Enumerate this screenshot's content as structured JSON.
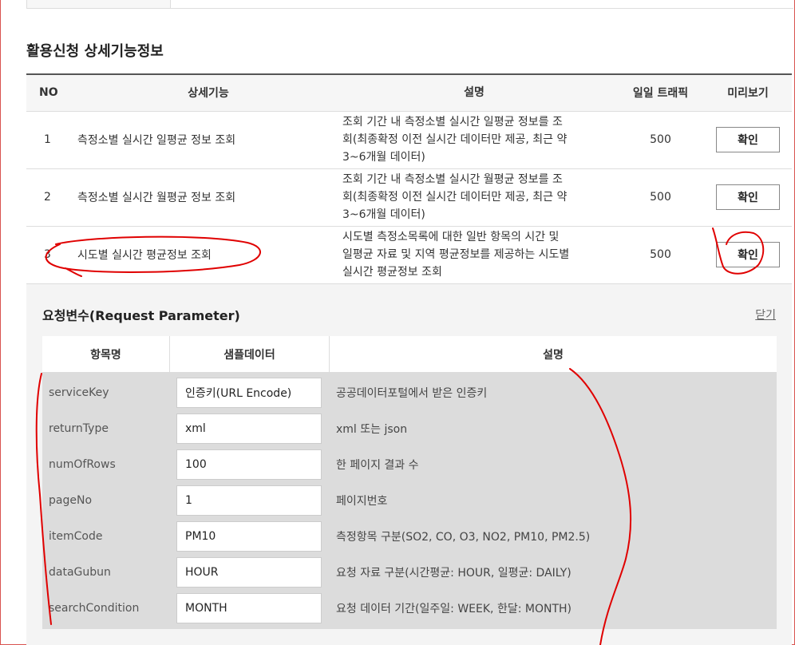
{
  "section_title": "활용신청 상세기능정보",
  "detail_table": {
    "headers": [
      "NO",
      "상세기능",
      "설명",
      "일일 트래픽",
      "미리보기"
    ],
    "rows": [
      {
        "no": "1",
        "func": "측정소별 실시간 일평균 정보 조회",
        "desc": [
          "조회 기간 내 측정소별 실시간 일평균 정보를 조",
          "회(최종확정 이전 실시간 데이터만 제공, 최근 약",
          "3~6개월 데이터)"
        ],
        "traffic": "500",
        "button": "확인"
      },
      {
        "no": "2",
        "func": "측정소별 실시간 월평균 정보 조회",
        "desc": [
          "조회 기간 내 측정소별 실시간 월평균 정보를 조",
          "회(최종확정 이전 실시간 데이터만 제공, 최근 약",
          "3~6개월 데이터)"
        ],
        "traffic": "500",
        "button": "확인"
      },
      {
        "no": "3",
        "func": "시도별 실시간 평균정보 조회",
        "desc": [
          "시도별 측정소목록에 대한 일반 항목의 시간 및",
          "일평균 자료 및 지역 평균정보를 제공하는 시도별",
          "실시간 평균정보 조회"
        ],
        "traffic": "500",
        "button": "확인"
      }
    ]
  },
  "param_panel": {
    "title": "요청변수(Request Parameter)",
    "close_label": "닫기",
    "headers": [
      "항목명",
      "샘플데이터",
      "설명"
    ],
    "rows": [
      {
        "name": "serviceKey",
        "sample": "인증키(URL Encode)",
        "desc": "공공데이터포털에서 받은 인증키"
      },
      {
        "name": "returnType",
        "sample": "xml",
        "desc": "xml 또는 json"
      },
      {
        "name": "numOfRows",
        "sample": "100",
        "desc": "한 페이지 결과 수"
      },
      {
        "name": "pageNo",
        "sample": "1",
        "desc": "페이지번호"
      },
      {
        "name": "itemCode",
        "sample": "PM10",
        "desc": "측정항목 구분(SO2, CO, O3, NO2, PM10, PM2.5)"
      },
      {
        "name": "dataGubun",
        "sample": "HOUR",
        "desc": "요청 자료 구분(시간평균: HOUR, 일평균: DAILY)"
      },
      {
        "name": "searchCondition",
        "sample": "MONTH",
        "desc": "요청 데이터 기간(일주일: WEEK, 한달: MONTH)"
      }
    ]
  },
  "annotation_color": "#e00000"
}
